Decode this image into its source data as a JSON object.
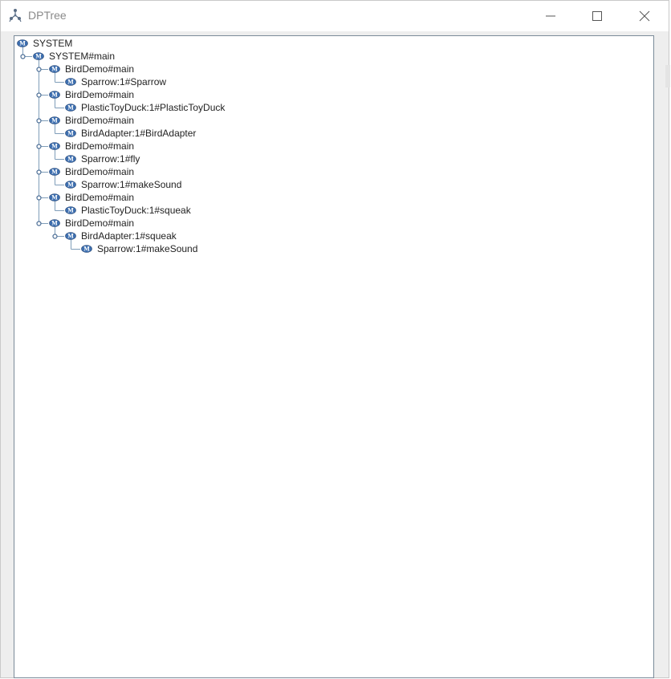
{
  "window": {
    "title": "DPTree"
  },
  "icons": {
    "app": "tree-structure-icon",
    "node": "method-m-icon",
    "minimize": "minimize-icon",
    "maximize": "maximize-icon",
    "close": "close-icon",
    "expanded_handle": "expanded-handle-icon"
  },
  "colors": {
    "node_icon_fill": "#3d6fb0",
    "tree_line": "#7f9db9",
    "handle": "#4d6f97",
    "label_text": "#222222",
    "title_text": "#8a8a8a"
  },
  "tree": {
    "nodes": [
      {
        "label": "SYSTEM",
        "depth": 0,
        "expanded": false,
        "last_child": false
      },
      {
        "label": "SYSTEM#main",
        "depth": 1,
        "expanded": true,
        "last_child": true
      },
      {
        "label": "BirdDemo#main",
        "depth": 2,
        "expanded": true,
        "last_child": false
      },
      {
        "label": "Sparrow:1#Sparrow",
        "depth": 3,
        "expanded": false,
        "last_child": true
      },
      {
        "label": "BirdDemo#main",
        "depth": 2,
        "expanded": true,
        "last_child": false
      },
      {
        "label": "PlasticToyDuck:1#PlasticToyDuck",
        "depth": 3,
        "expanded": false,
        "last_child": true
      },
      {
        "label": "BirdDemo#main",
        "depth": 2,
        "expanded": true,
        "last_child": false
      },
      {
        "label": "BirdAdapter:1#BirdAdapter",
        "depth": 3,
        "expanded": false,
        "last_child": true
      },
      {
        "label": "BirdDemo#main",
        "depth": 2,
        "expanded": true,
        "last_child": false
      },
      {
        "label": "Sparrow:1#fly",
        "depth": 3,
        "expanded": false,
        "last_child": true
      },
      {
        "label": "BirdDemo#main",
        "depth": 2,
        "expanded": true,
        "last_child": false
      },
      {
        "label": "Sparrow:1#makeSound",
        "depth": 3,
        "expanded": false,
        "last_child": true
      },
      {
        "label": "BirdDemo#main",
        "depth": 2,
        "expanded": true,
        "last_child": false
      },
      {
        "label": "PlasticToyDuck:1#squeak",
        "depth": 3,
        "expanded": false,
        "last_child": true
      },
      {
        "label": "BirdDemo#main",
        "depth": 2,
        "expanded": true,
        "last_child": true
      },
      {
        "label": "BirdAdapter:1#squeak",
        "depth": 3,
        "expanded": true,
        "last_child": true
      },
      {
        "label": "Sparrow:1#makeSound",
        "depth": 4,
        "expanded": false,
        "last_child": true
      }
    ]
  }
}
